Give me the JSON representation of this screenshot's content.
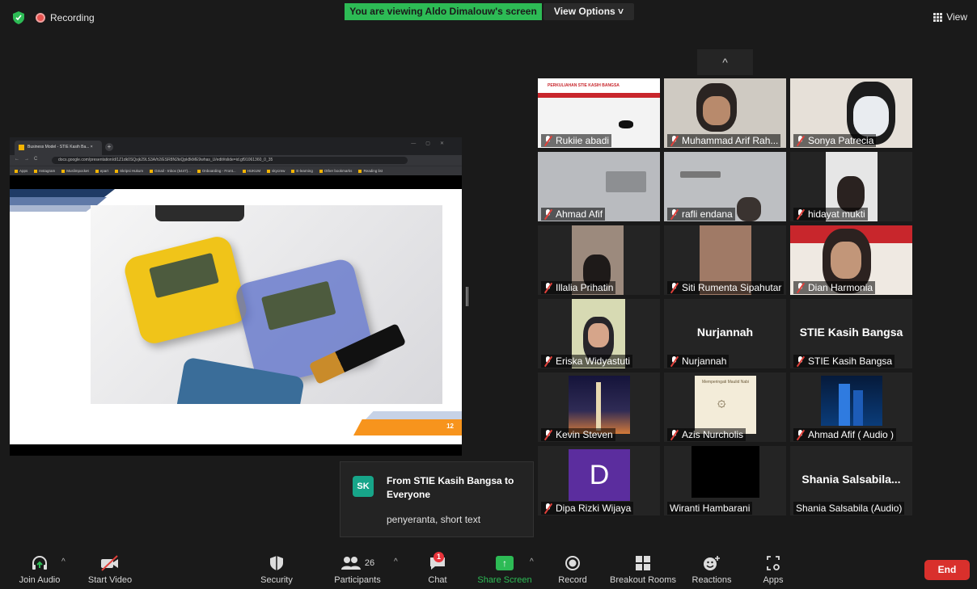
{
  "top": {
    "recording_label": "Recording",
    "viewing_banner": "You are viewing Aldo Dimalouw's screen",
    "view_options_label": "View Options ˅",
    "view_label": "View"
  },
  "browser": {
    "tab_title": "Business Model - STIE Kasih Ba...  ×",
    "address": "docs.google.com/presentation/d/1Z1dk0SQxjk29LS3A/h2/ESR8N2kiQpk8kME9whas_U/edit#slide=id.gf91061360_0_35",
    "bookmarks": [
      "Apps",
      "Instagram",
      "Muslimpocket",
      "epart",
      "Skripsi Hukum",
      "Gmail - Inbox (5447)...",
      "Onboarding - Front...",
      "HUKUM",
      "skycrew",
      "E-learning",
      "Other bookmarks",
      "Reading list"
    ]
  },
  "slide": {
    "page_number": "12"
  },
  "gallery": {
    "collapse_label": "^",
    "tiles": [
      {
        "name": "Rukiie abadi",
        "banner": "PERKULIAHAN STIE KASIH BANGSA"
      },
      {
        "name": "Muhammad Arif Rah..."
      },
      {
        "name": "Sonya Patrecia"
      },
      {
        "name": "Ahmad Afif"
      },
      {
        "name": "rafli endana"
      },
      {
        "name": "hidayat mukti"
      },
      {
        "name": "Illalia Prihatin"
      },
      {
        "name": "Siti Rumenta Sipahutar"
      },
      {
        "name": "Dian Harmonia"
      },
      {
        "name": "Eriska Widyastuti"
      },
      {
        "name": "Nurjannah",
        "center": "Nurjannah"
      },
      {
        "name": "STIE Kasih Bangsa",
        "center": "STIE Kasih Bangsa"
      },
      {
        "name": "Kevin Steven"
      },
      {
        "name": "Azis Nurcholis",
        "card": "Memperingati Maulid Nabi"
      },
      {
        "name": "Ahmad Afif ( Audio )"
      },
      {
        "name": "Dipa Rizki Wijaya",
        "avatar": "D"
      },
      {
        "name": "Wiranti Hambarani"
      },
      {
        "name": "Shania Salsabila (Audio)",
        "center": "Shania  Salsabila..."
      }
    ]
  },
  "chat": {
    "initials": "SK",
    "from": "From STIE Kasih Bangsa to Everyone",
    "message": "penyeranta, short text"
  },
  "toolbar": {
    "join_audio": "Join Audio",
    "start_video": "Start Video",
    "security": "Security",
    "participants": "Participants",
    "participants_count": "26",
    "chat": "Chat",
    "chat_badge": "1",
    "share_screen": "Share Screen",
    "record": "Record",
    "breakout_rooms": "Breakout Rooms",
    "reactions": "Reactions",
    "apps": "Apps",
    "end": "End"
  },
  "colors": {
    "accent_green": "#2dbb55",
    "end_red": "#d9302c",
    "muted_red": "#e0403a"
  }
}
